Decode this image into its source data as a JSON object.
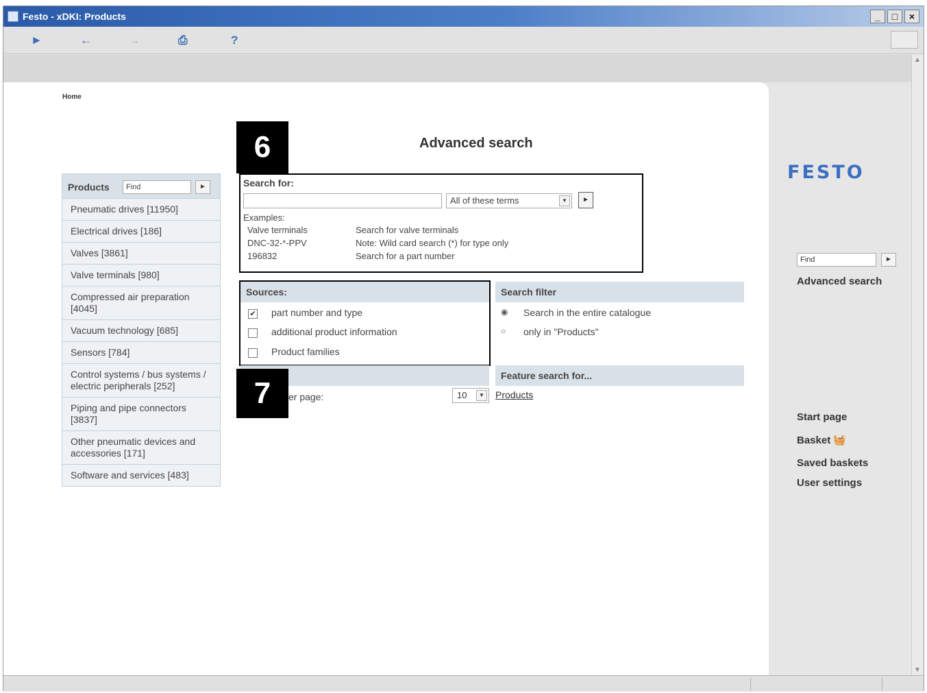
{
  "window": {
    "title": "Festo - xDKI: Products",
    "controls": [
      "_",
      "□",
      "×"
    ]
  },
  "toolbar": {
    "icons": [
      "home-icon",
      "back-icon",
      "forward-icon",
      "print-icon",
      "help-icon"
    ],
    "glyphs": [
      "►",
      "←",
      "→",
      "⎙",
      "?"
    ]
  },
  "breadcrumb": {
    "home": "Home"
  },
  "products_nav": {
    "header": "Products",
    "find_placeholder": "Find",
    "go": "►",
    "items": [
      "Pneumatic drives [11950]",
      "Electrical drives [186]",
      "Valves [3861]",
      "Valve terminals [980]",
      "Compressed air preparation [4045]",
      "Vacuum technology [685]",
      "Sensors [784]",
      "Control systems / bus systems / electric peripherals [252]",
      "Piping and pipe connectors [3837]",
      "Other pneumatic devices and accessories [171]",
      "Software and services [483]"
    ]
  },
  "advanced_search": {
    "title": "Advanced search",
    "search_for_label": "Search for:",
    "search_value": "",
    "match_mode": "All of these terms",
    "go": "►",
    "examples_label": "Examples:",
    "examples": [
      {
        "term": "Valve terminals",
        "desc": "Search for valve terminals"
      },
      {
        "term": "DNC-32-*-PPV",
        "desc": "Note: Wild card search (*) for type only"
      },
      {
        "term": "196832",
        "desc": "Search for a part number"
      }
    ]
  },
  "sources": {
    "header": "Sources:",
    "options": [
      {
        "label": "part number and type",
        "checked": true
      },
      {
        "label": "additional product information",
        "checked": false
      },
      {
        "label": "Product families",
        "checked": false
      }
    ]
  },
  "search_filter": {
    "header": "Search filter",
    "options": [
      {
        "label": "Search in the entire catalogue",
        "selected": true
      },
      {
        "label": "only in \"Products\"",
        "selected": false
      }
    ]
  },
  "results": {
    "per_page_label": "er page:",
    "per_page_value": "10"
  },
  "feature_search": {
    "header": "Feature search for...",
    "link": "Products"
  },
  "callouts": {
    "a": "6",
    "b": "7"
  },
  "right_panel": {
    "logo": "FESTO",
    "find_placeholder": "Find",
    "go": "►",
    "advanced_search": "Advanced search",
    "links": [
      "Start page",
      "Basket",
      "Saved baskets",
      "User settings"
    ],
    "basket_icon": "basket-icon"
  },
  "colors": {
    "titlebar": "#2a5aa8",
    "panel_header": "#d9e1e8",
    "logo": "#3b6fc0"
  }
}
